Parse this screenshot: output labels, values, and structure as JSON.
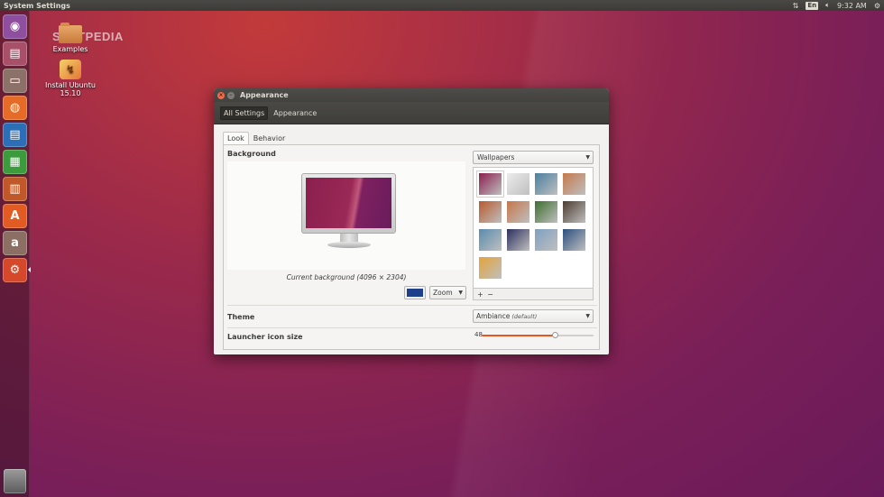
{
  "top_panel": {
    "app_title": "System Settings",
    "keyboard_layout": "En",
    "clock": "9:32 AM"
  },
  "desktop": {
    "watermark": "SOFTPEDIA",
    "icons": [
      {
        "label": "Examples",
        "icon": "folder-icon"
      },
      {
        "label": "Install Ubuntu 15.10",
        "icon": "installer-icon"
      }
    ]
  },
  "launcher": {
    "items": [
      {
        "name": "dash-home",
        "color": "#8d4f9e"
      },
      {
        "name": "files",
        "color": "#a84f6a"
      },
      {
        "name": "file-manager",
        "color": "#8b7168"
      },
      {
        "name": "firefox",
        "color": "#e56b26"
      },
      {
        "name": "writer",
        "color": "#2d6fb6"
      },
      {
        "name": "calc",
        "color": "#3c9b3c"
      },
      {
        "name": "impress",
        "color": "#c0582a"
      },
      {
        "name": "software-center",
        "color": "#e25b22"
      },
      {
        "name": "amazon",
        "color": "#8a6f62"
      },
      {
        "name": "system-settings",
        "color": "#d5492a"
      }
    ],
    "trash": "trash"
  },
  "window": {
    "title": "Appearance",
    "toolbar": {
      "all_settings": "All Settings",
      "appearance": "Appearance"
    },
    "tabs": {
      "look": "Look",
      "behavior": "Behavior"
    },
    "background": {
      "label": "Background",
      "caption": "Current background (4096 × 2304)",
      "color": "#1e3f8a",
      "mode": "Zoom",
      "source": "Wallpapers"
    },
    "wallpapers": [
      "#8a1f4e",
      "#ececec",
      "#4a7fa0",
      "#c47a4a",
      "#b85a2e",
      "#c6774a",
      "#3e6e2e",
      "#4c3b30",
      "#5a8cae",
      "#2e2f5e",
      "#7fa0c0",
      "#2c4f7f",
      "#e4a33a"
    ],
    "theme": {
      "label": "Theme",
      "value": "Ambiance",
      "suffix": "(default)"
    },
    "launcher_icon_size": {
      "label": "Launcher icon size",
      "value": "48",
      "fraction": 0.65
    }
  }
}
